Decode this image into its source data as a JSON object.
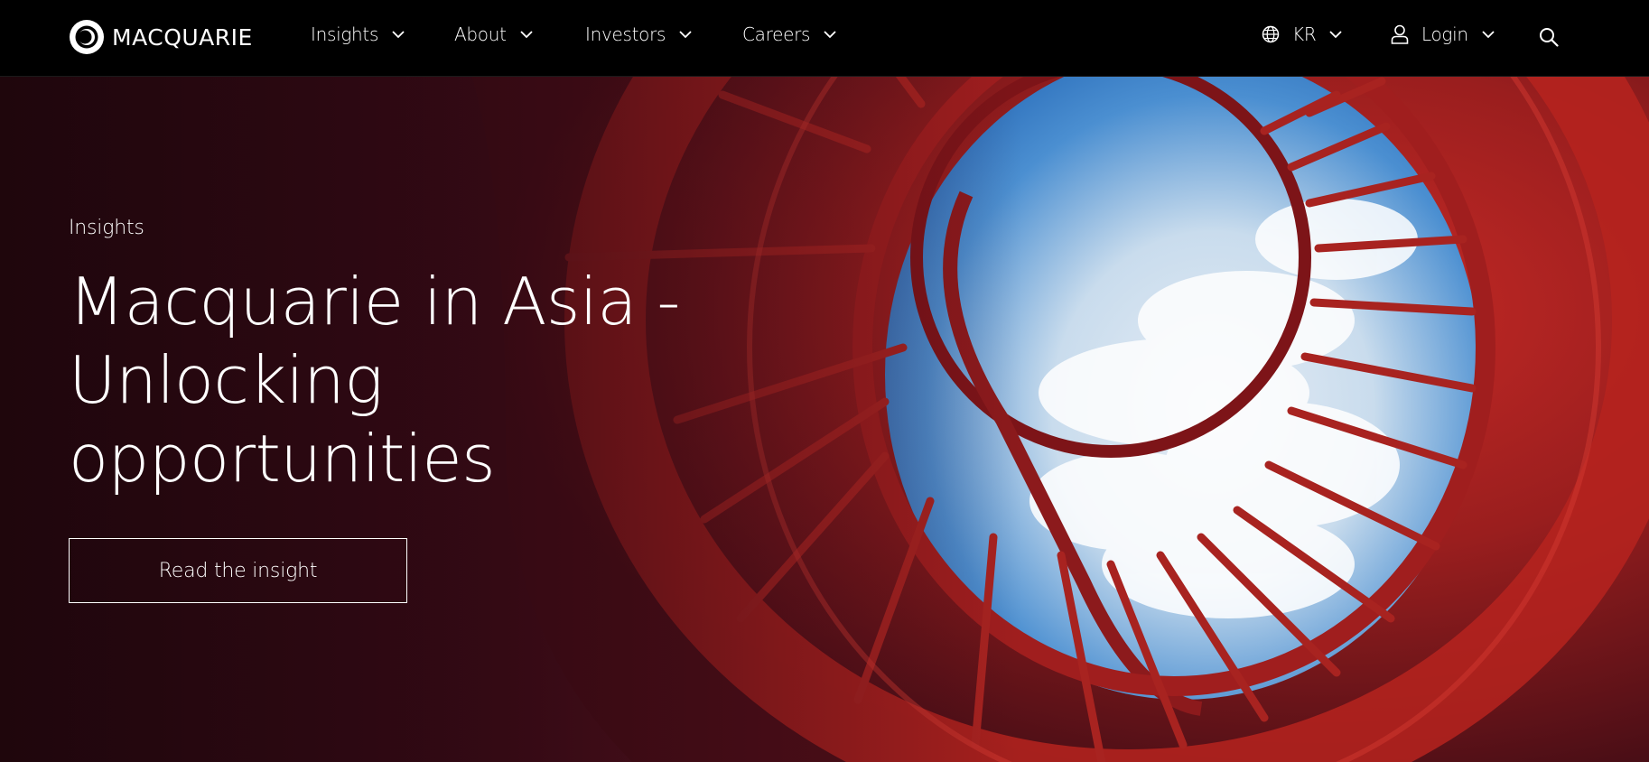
{
  "brand": {
    "name": "MACQUARIE",
    "logo_icon": "macquarie-holey-dollar-icon"
  },
  "nav": {
    "items": [
      {
        "label": "Insights"
      },
      {
        "label": "About"
      },
      {
        "label": "Investors"
      },
      {
        "label": "Careers"
      }
    ],
    "region": {
      "label": "KR",
      "icon": "globe-icon"
    },
    "login": {
      "label": "Login",
      "icon": "user-icon"
    },
    "search": {
      "icon": "search-icon"
    }
  },
  "hero": {
    "eyebrow": "Insights",
    "headline_line1": "Macquarie in Asia - Unlocking",
    "headline_line2": "opportunities",
    "cta_label": "Read the insight",
    "image_subject": "red spiral staircase looking up to blue sky"
  },
  "colors": {
    "nav_bg": "#000000",
    "hero_red": "#8e1c1c",
    "hero_dark": "#2a0810",
    "sky": "#3b82c8"
  }
}
